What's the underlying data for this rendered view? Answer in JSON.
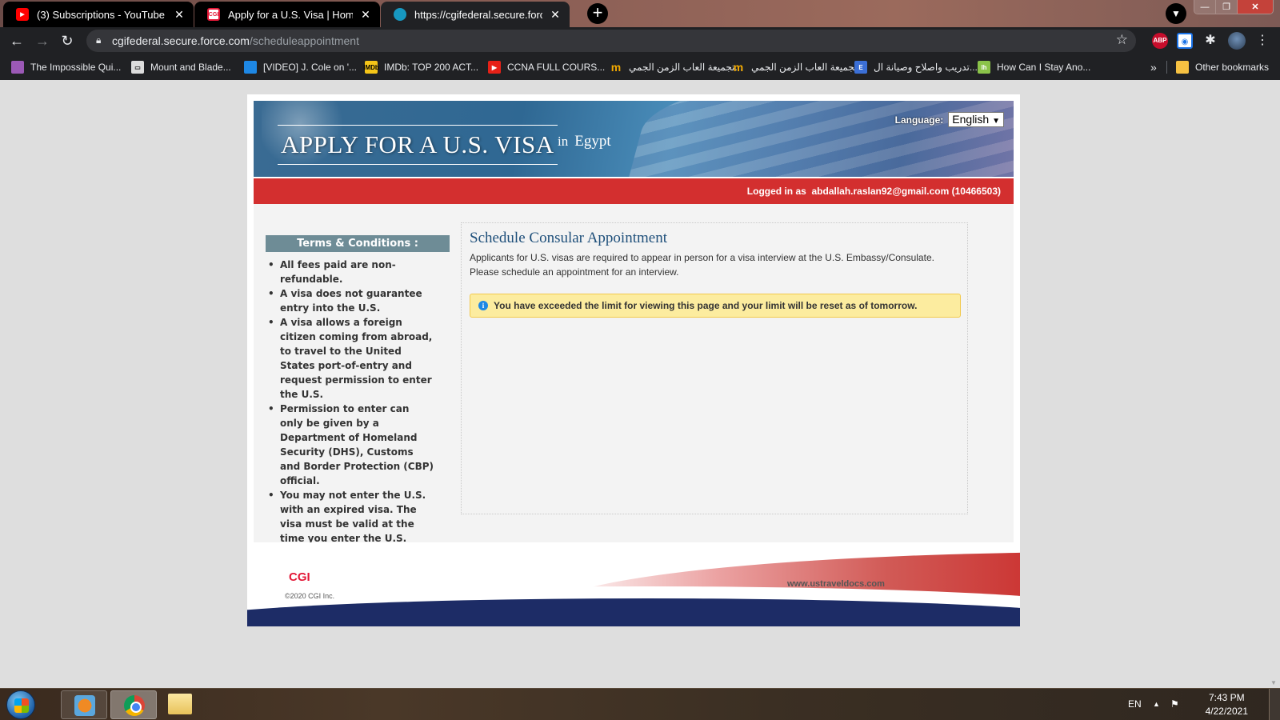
{
  "browser": {
    "tabs": [
      {
        "title": "(3) Subscriptions - YouTube",
        "favicon": "youtube-icon",
        "active": false
      },
      {
        "title": "Apply for a U.S. Visa | Home - Eg",
        "favicon": "cgi-icon",
        "favicon_text": "CGI",
        "active": false
      },
      {
        "title": "https://cgifederal.secure.force.co",
        "favicon": "salesforce-icon",
        "active": true
      }
    ],
    "new_tab": "+",
    "url_host": "cgifederal.secure.force.com",
    "url_path": "/scheduleappointment",
    "extensions": [
      {
        "name": "adblock-plus-icon",
        "label": "ABP"
      },
      {
        "name": "screen-capture-icon",
        "label": "◉"
      },
      {
        "name": "extensions-puzzle-icon",
        "label": "✱"
      }
    ],
    "bookmarks": [
      {
        "label": "The Impossible Qui...",
        "icon": "game-icon",
        "color": "#9b59b6"
      },
      {
        "label": "Mount and Blade...",
        "icon": "computer-icon",
        "color": "#dddddd"
      },
      {
        "label": "[VIDEO] J. Cole on '...",
        "icon": "video-icon",
        "color": "#1e88e5"
      },
      {
        "label": "IMDb: TOP 200 ACT...",
        "icon": "imdb-icon",
        "color": "#f5c518"
      },
      {
        "label": "CCNA FULL COURS...",
        "icon": "youtube-icon",
        "color": "#e62117"
      },
      {
        "label": "تجميعة العاب الزمن الجمي...",
        "icon": "m-icon",
        "color": "#f2a900"
      },
      {
        "label": "تجميعة العاب الزمن الجمي...",
        "icon": "m-icon",
        "color": "#f2a900"
      },
      {
        "label": "تدريب واصلاح وصيانة ال...",
        "icon": "e-icon",
        "color": "#3b6fd6"
      },
      {
        "label": "How Can I Stay Ano...",
        "icon": "lh-icon",
        "color": "#8bc34a"
      }
    ],
    "bookmarks_overflow": "»",
    "other_bookmarks": "Other bookmarks"
  },
  "header": {
    "title": "APPLY FOR A U.S. VISA",
    "in_label": "in",
    "country": "Egypt",
    "language_label": "Language:",
    "language_selected": "English",
    "logged_in_prefix": "Logged in as",
    "user_email": "abdallah.raslan92@gmail.com",
    "user_id": "(10466503)"
  },
  "sidebar": {
    "heading": "Terms & Conditions :",
    "items": [
      "All fees paid are non-refundable.",
      "A visa does not guarantee entry into the U.S.",
      "A visa allows a foreign citizen coming from abroad, to travel to the United States port-of-entry and request permission to enter the U.S.",
      "Permission to enter can only be given by a Department of Homeland Security (DHS), Customs and Border Protection (CBP) official.",
      "You may not enter the U.S. with an expired visa. The visa must be valid at the time you enter the U.S."
    ]
  },
  "main": {
    "title": "Schedule Consular Appointment",
    "description": "Applicants for U.S. visas are required to appear in person for a visa interview at the U.S. Embassy/Consulate. Please schedule an appointment for an interview.",
    "alert_icon": "i",
    "alert": "You have exceeded the limit for viewing this page and your limit will be reset as of tomorrow."
  },
  "footer": {
    "brand": "CGI",
    "copyright": "©2020 CGI Inc.",
    "site": "www.ustraveldocs.com"
  },
  "taskbar": {
    "language": "EN",
    "time": "7:43 PM",
    "date": "4/22/2021"
  }
}
